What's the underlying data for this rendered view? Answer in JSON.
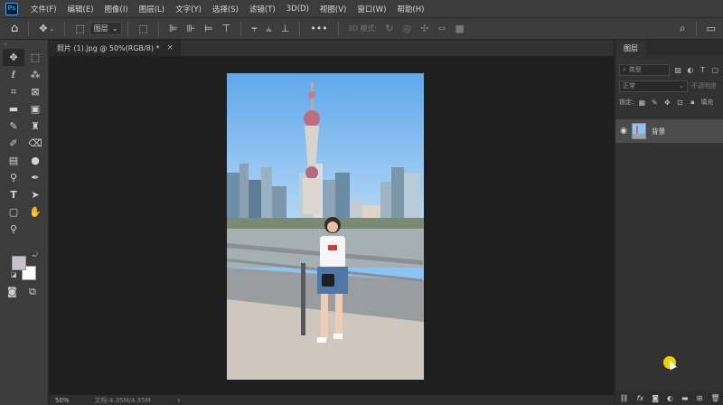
{
  "menubar": {
    "logo": "Ps",
    "items": [
      "文件(F)",
      "编辑(E)",
      "图像(I)",
      "图层(L)",
      "文字(Y)",
      "选择(S)",
      "滤镜(T)",
      "3D(D)",
      "视图(V)",
      "窗口(W)",
      "帮助(H)"
    ]
  },
  "options": {
    "auto_select": "图层",
    "mode_3d": "3D 模式:"
  },
  "document": {
    "tab_title": "照片 (1).jpg @ 50%(RGB/8) *",
    "close": "×"
  },
  "status": {
    "zoom": "50%",
    "doc_size": "文档:4.35M/4.35M",
    "arrow": "›"
  },
  "layers_panel": {
    "tab": "图层",
    "filter_kind": "类型",
    "blend_mode": "正常",
    "opacity_label": "不透明度",
    "lock_label": "锁定:",
    "fill_label": "填充",
    "layers": [
      {
        "name": "背景",
        "visible": true,
        "selected": true
      }
    ]
  },
  "colors": {
    "foreground": "#c8bfd0",
    "background": "#ffffff",
    "accent_cursor": "#f0d000"
  }
}
